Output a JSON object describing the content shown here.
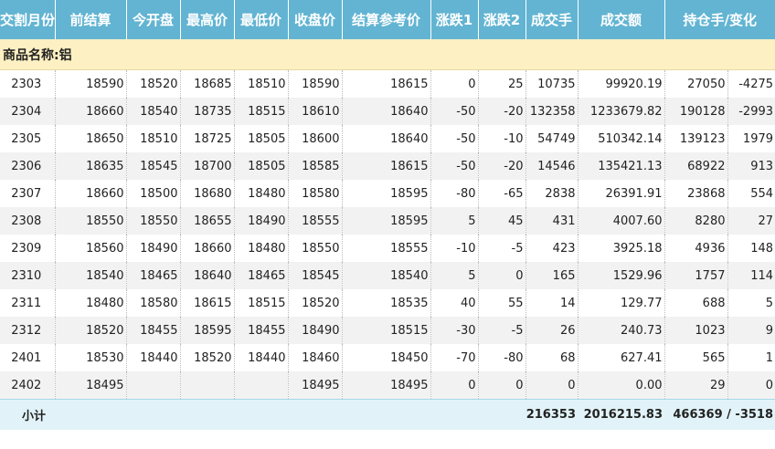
{
  "headers": [
    "交割月份",
    "前结算",
    "今开盘",
    "最高价",
    "最低价",
    "收盘价",
    "结算参考价",
    "涨跌1",
    "涨跌2",
    "成交手",
    "成交额",
    "持仓手/变化"
  ],
  "product_label": "商品名称:铝",
  "rows": [
    [
      "2303",
      "18590",
      "18520",
      "18685",
      "18510",
      "18590",
      "18615",
      "0",
      "25",
      "10735",
      "99920.19",
      "27050",
      "-4275"
    ],
    [
      "2304",
      "18660",
      "18540",
      "18735",
      "18515",
      "18610",
      "18640",
      "-50",
      "-20",
      "132358",
      "1233679.82",
      "190128",
      "-2993"
    ],
    [
      "2305",
      "18650",
      "18510",
      "18725",
      "18505",
      "18600",
      "18640",
      "-50",
      "-10",
      "54749",
      "510342.14",
      "139123",
      "1979"
    ],
    [
      "2306",
      "18635",
      "18545",
      "18700",
      "18505",
      "18585",
      "18615",
      "-50",
      "-20",
      "14546",
      "135421.13",
      "68922",
      "913"
    ],
    [
      "2307",
      "18660",
      "18500",
      "18680",
      "18480",
      "18580",
      "18595",
      "-80",
      "-65",
      "2838",
      "26391.91",
      "23868",
      "554"
    ],
    [
      "2308",
      "18550",
      "18550",
      "18655",
      "18490",
      "18555",
      "18595",
      "5",
      "45",
      "431",
      "4007.60",
      "8280",
      "27"
    ],
    [
      "2309",
      "18560",
      "18490",
      "18660",
      "18480",
      "18550",
      "18555",
      "-10",
      "-5",
      "423",
      "3925.18",
      "4936",
      "148"
    ],
    [
      "2310",
      "18540",
      "18465",
      "18640",
      "18465",
      "18545",
      "18540",
      "5",
      "0",
      "165",
      "1529.96",
      "1757",
      "114"
    ],
    [
      "2311",
      "18480",
      "18580",
      "18615",
      "18515",
      "18520",
      "18535",
      "40",
      "55",
      "14",
      "129.77",
      "688",
      "5"
    ],
    [
      "2312",
      "18520",
      "18455",
      "18595",
      "18455",
      "18490",
      "18515",
      "-30",
      "-5",
      "26",
      "240.73",
      "1023",
      "9"
    ],
    [
      "2401",
      "18530",
      "18440",
      "18520",
      "18440",
      "18460",
      "18450",
      "-70",
      "-80",
      "68",
      "627.41",
      "565",
      "1"
    ],
    [
      "2402",
      "18495",
      "",
      "",
      "",
      "18495",
      "18495",
      "0",
      "0",
      "0",
      "0.00",
      "29",
      "0"
    ]
  ],
  "subtotal": {
    "label": "小计",
    "volume": "216353",
    "turnover": "2016215.83",
    "open_interest": "466369 / -3518"
  }
}
